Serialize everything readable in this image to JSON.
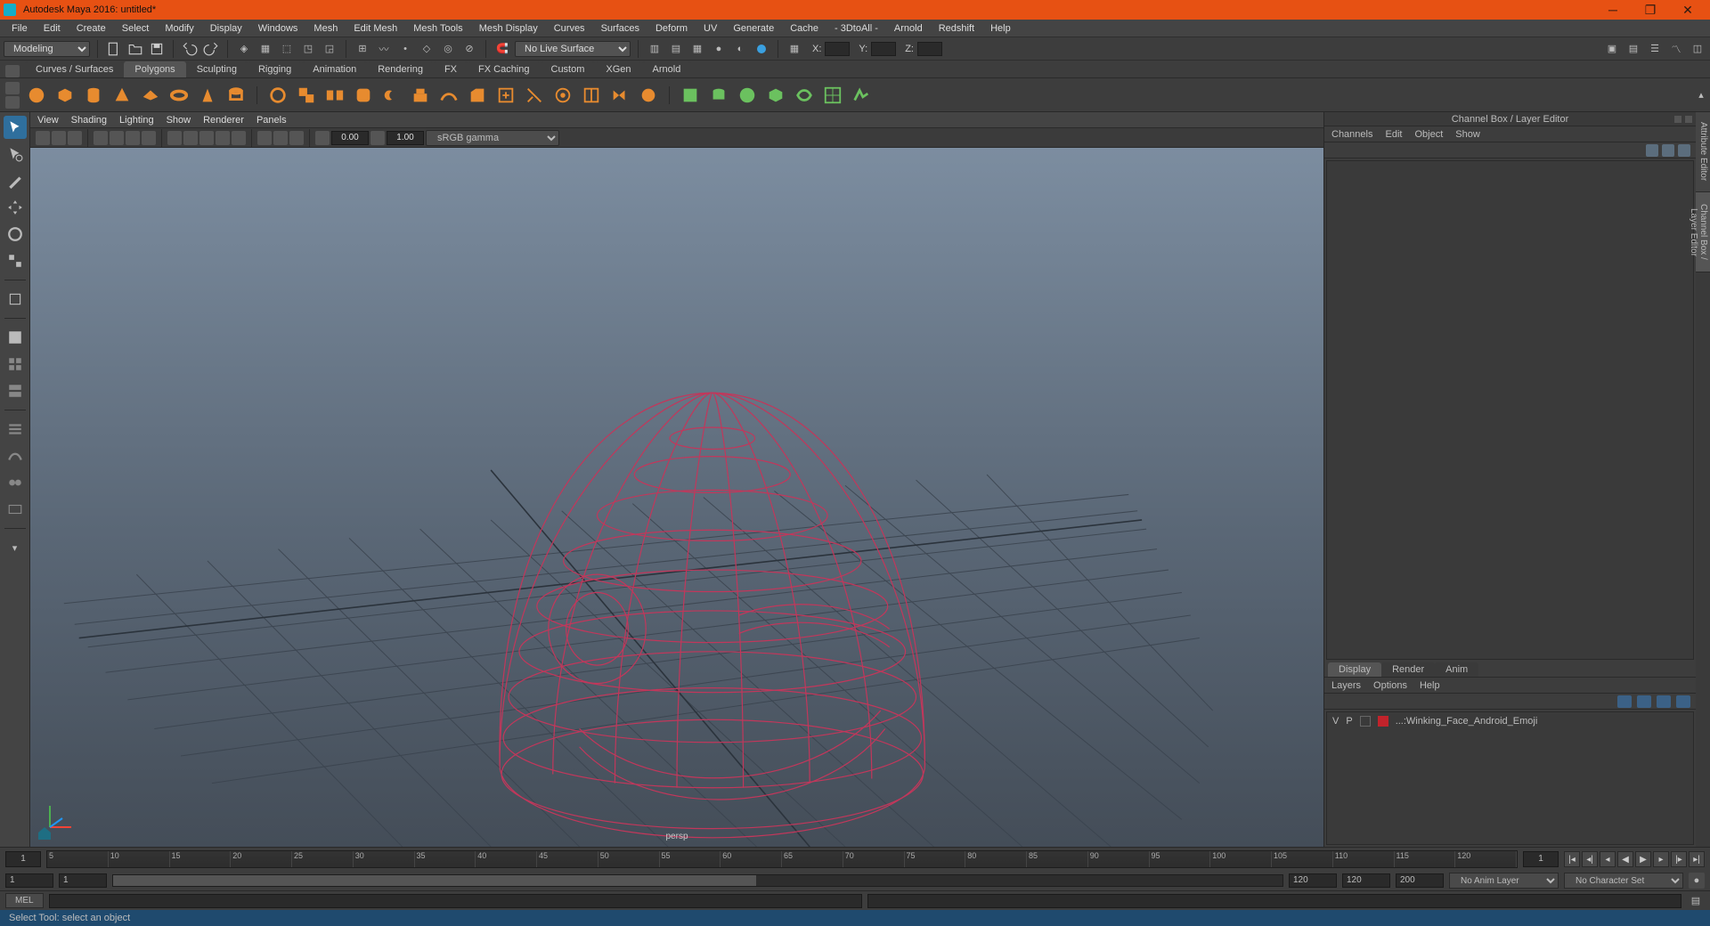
{
  "title": "Autodesk Maya 2016: untitled*",
  "mainmenu": [
    "File",
    "Edit",
    "Create",
    "Select",
    "Modify",
    "Display",
    "Windows",
    "Mesh",
    "Edit Mesh",
    "Mesh Tools",
    "Mesh Display",
    "Curves",
    "Surfaces",
    "Deform",
    "UV",
    "Generate",
    "Cache",
    "- 3DtoAll -",
    "Arnold",
    "Redshift",
    "Help"
  ],
  "workspace_dropdown": "Modeling",
  "live_surface": "No Live Surface",
  "coords": {
    "x_label": "X:",
    "y_label": "Y:",
    "z_label": "Z:"
  },
  "shelf_tabs": [
    "Curves / Surfaces",
    "Polygons",
    "Sculpting",
    "Rigging",
    "Animation",
    "Rendering",
    "FX",
    "FX Caching",
    "Custom",
    "XGen",
    "Arnold"
  ],
  "shelf_active": "Polygons",
  "panel_menu": [
    "View",
    "Shading",
    "Lighting",
    "Show",
    "Renderer",
    "Panels"
  ],
  "panel_numbers": {
    "a": "0.00",
    "b": "1.00"
  },
  "panel_colorspace": "sRGB gamma",
  "camera_label": "persp",
  "channelbox": {
    "title": "Channel Box / Layer Editor",
    "menu": [
      "Channels",
      "Edit",
      "Object",
      "Show"
    ],
    "layer_tabs": [
      "Display",
      "Render",
      "Anim"
    ],
    "layer_tabs_active": "Display",
    "layer_menu": [
      "Layers",
      "Options",
      "Help"
    ],
    "layers": [
      {
        "v": "V",
        "p": "P",
        "color": "#c1232b",
        "name": "...:Winking_Face_Android_Emoji"
      }
    ]
  },
  "side_tabs": [
    "Attribute Editor",
    "Channel Box / Layer Editor"
  ],
  "side_tabs_active": "Channel Box / Layer Editor",
  "timeline": {
    "ticks": [
      "5",
      "10",
      "15",
      "20",
      "25",
      "30",
      "35",
      "40",
      "45",
      "50",
      "55",
      "60",
      "65",
      "70",
      "75",
      "80",
      "85",
      "90",
      "95",
      "100",
      "105",
      "110",
      "115",
      "120"
    ],
    "current": "1",
    "current2": "1"
  },
  "range": {
    "start": "1",
    "in": "1",
    "out": "120",
    "end": "120",
    "fps": "200"
  },
  "anim_layer": "No Anim Layer",
  "char_set": "No Character Set",
  "cmd_lang": "MEL",
  "helpline": "Select Tool: select an object"
}
